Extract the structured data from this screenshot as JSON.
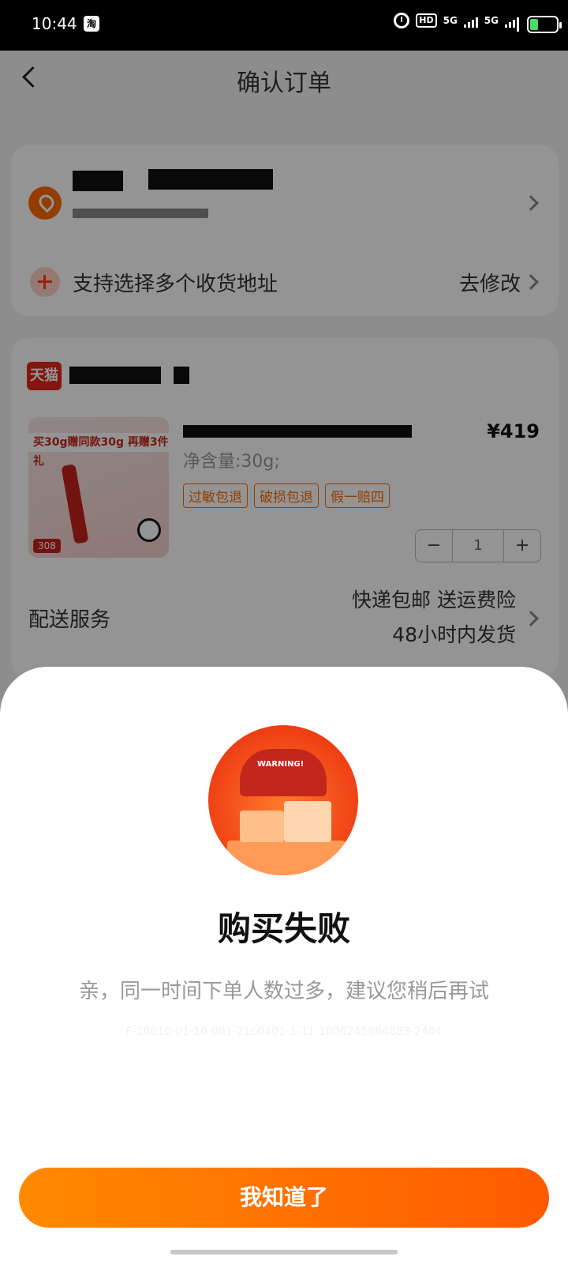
{
  "status_bar": {
    "time": "10:44",
    "app_badge": "淘",
    "hd_label": "HD",
    "network_1": "5G",
    "network_2": "5G"
  },
  "header": {
    "title": "确认订单"
  },
  "address_card": {
    "multi_address_label": "支持选择多个收货地址",
    "edit_label": "去修改"
  },
  "order_card": {
    "store_badge": "天猫",
    "product_image": {
      "banner_text": "买30g赠同款30g 再赠3件礼",
      "price_tag": "308"
    },
    "price": "¥419",
    "spec": "净含量:30g;",
    "tags": [
      "过敏包退",
      "破损包退",
      "假一赔四"
    ],
    "quantity": "1",
    "minus_label": "−",
    "plus_label": "+",
    "delivery_label": "配送服务",
    "delivery_line1": "快递包邮 送运费险",
    "delivery_line2": "48小时内发货"
  },
  "dialog": {
    "illustration_text": "WARNING!",
    "title": "购买失败",
    "message": "亲，同一时间下单人数过多，建议您稍后再试",
    "trace_id": "F-10010-01-16-001-2160401-1-11-1000245864883-2404",
    "confirm_label": "我知道了"
  },
  "colors": {
    "accent": "#ff6a00",
    "button_start": "#ff8a00",
    "button_end": "#ff5a00",
    "tmall_red": "#e6261a"
  }
}
